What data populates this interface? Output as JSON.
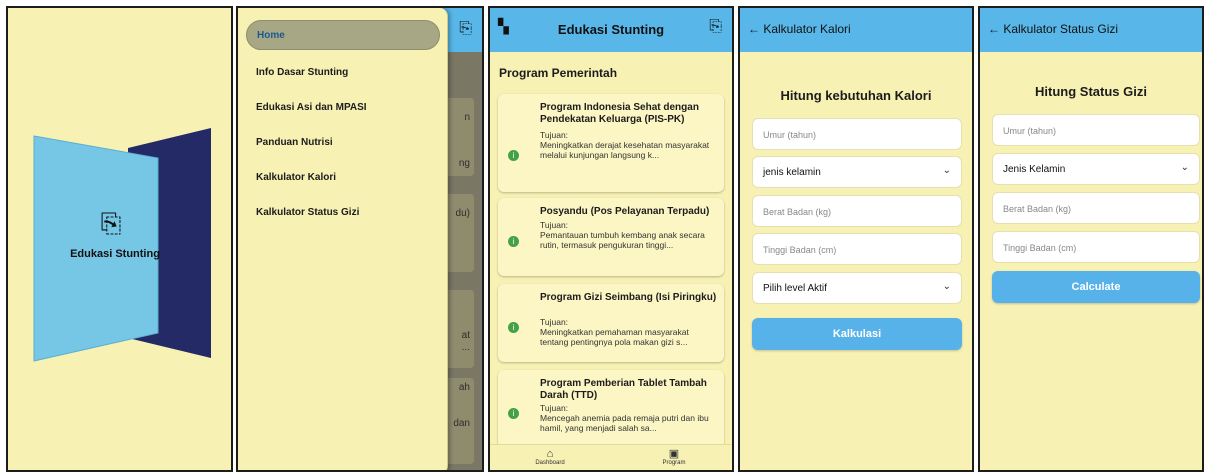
{
  "splash": {
    "title": "Edukasi Stunting",
    "logo_icon": "scroll-book-icon"
  },
  "drawer": {
    "items": [
      {
        "label": "Home",
        "active": true
      },
      {
        "label": "Info Dasar Stunting"
      },
      {
        "label": "Edukasi Asi dan MPASI"
      },
      {
        "label": "Panduan Nutrisi"
      },
      {
        "label": "Kalkulator Kalori"
      },
      {
        "label": "Kalkulator Status Gizi"
      }
    ],
    "background_fragments": [
      "n",
      "ng",
      "du)",
      "at",
      "...",
      "ah",
      "dan"
    ]
  },
  "program": {
    "app_title": "Edukasi Stunting",
    "section_title": "Program Pemerintah",
    "cards": [
      {
        "title": "Program Indonesia Sehat dengan Pendekatan Keluarga (PIS-PK)",
        "label": "Tujuan:",
        "body": "Meningkatkan derajat kesehatan masyarakat melalui kunjungan langsung k..."
      },
      {
        "title": "Posyandu (Pos Pelayanan Terpadu)",
        "label": "Tujuan:",
        "body": "Pemantauan tumbuh kembang anak secara rutin, termasuk pengukuran tinggi..."
      },
      {
        "title": "Program Gizi Seimbang (Isi Piringku)",
        "label": "Tujuan:",
        "body": "Meningkatkan pemahaman masyarakat tentang pentingnya pola makan gizi s..."
      },
      {
        "title": "Program Pemberian Tablet Tambah Darah (TTD)",
        "label": "Tujuan:",
        "body": "Mencegah anemia pada remaja putri dan ibu hamil, yang menjadi salah sa..."
      }
    ],
    "nav": [
      {
        "label": "Dashboard",
        "icon": "home-icon"
      },
      {
        "label": "Program",
        "icon": "terminal-icon"
      }
    ]
  },
  "kalori": {
    "app_title": "← Kalkulator Kalori",
    "heading": "Hitung kebutuhan Kalori",
    "age_placeholder": "Umur (tahun)",
    "gender_value": "jenis kelamin",
    "weight_placeholder": "Berat Badan (kg)",
    "height_placeholder": "Tinggi Badan (cm)",
    "activity_value": "Pilih level Aktif",
    "button": "Kalkulasi"
  },
  "gizi": {
    "app_title": "← Kalkulator Status Gizi",
    "heading": "Hitung Status Gizi",
    "age_placeholder": "Umur (tahun)",
    "gender_value": "Jenis Kelamin",
    "weight_placeholder": "Berat Badan (kg)",
    "height_placeholder": "Tinggi Badan (cm)",
    "button": "Calculate"
  },
  "colors": {
    "appbar": "#58b7e8",
    "background": "#f7f1b4",
    "button": "#58b2ea",
    "door_light": "#76c6e6",
    "door_dark": "#232a66"
  }
}
